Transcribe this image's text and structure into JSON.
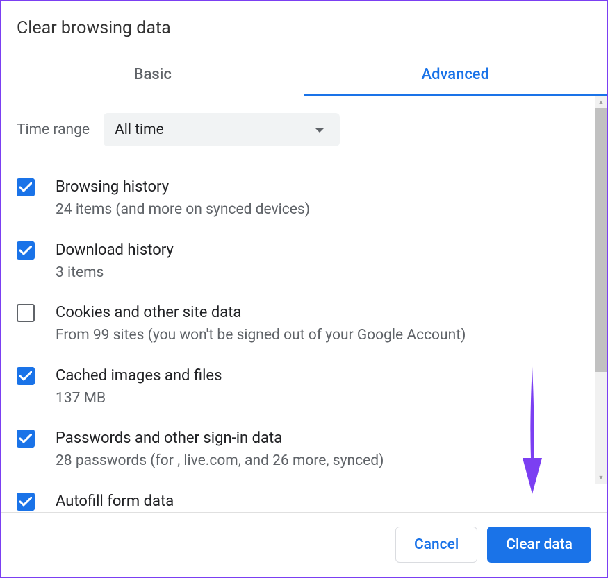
{
  "dialog": {
    "title": "Clear browsing data",
    "tabs": [
      {
        "label": "Basic",
        "active": false
      },
      {
        "label": "Advanced",
        "active": true
      }
    ],
    "time_range": {
      "label": "Time range",
      "value": "All time"
    },
    "options": [
      {
        "title": "Browsing history",
        "desc": "24 items (and more on synced devices)",
        "checked": true
      },
      {
        "title": "Download history",
        "desc": "3 items",
        "checked": true
      },
      {
        "title": "Cookies and other site data",
        "desc": "From 99 sites (you won't be signed out of your Google Account)",
        "checked": false
      },
      {
        "title": "Cached images and files",
        "desc": "137 MB",
        "checked": true
      },
      {
        "title": "Passwords and other sign-in data",
        "desc": "28 passwords (for , live.com, and 26 more, synced)",
        "checked": true
      },
      {
        "title": "Autofill form data",
        "desc": "",
        "checked": true
      }
    ],
    "buttons": {
      "cancel": "Cancel",
      "confirm": "Clear data"
    },
    "colors": {
      "primary": "#1a73e8",
      "annotation": "#7b3ff2"
    }
  }
}
